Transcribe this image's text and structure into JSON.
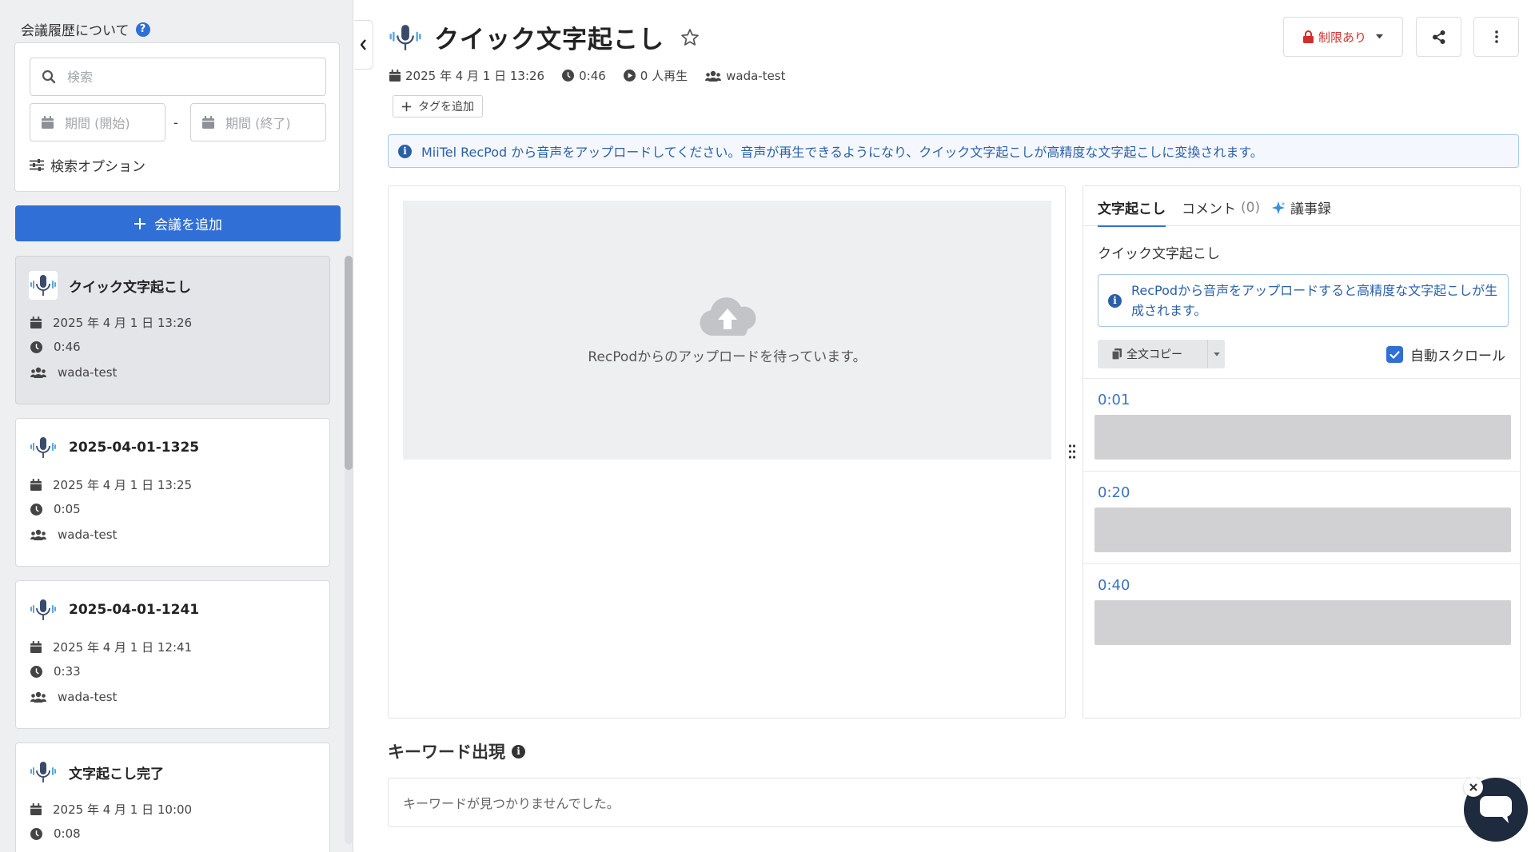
{
  "sidebar": {
    "title": "会議履歴について",
    "help_icon": "?",
    "search": {
      "placeholder": "検索",
      "value": ""
    },
    "date_start_placeholder": "期間 (開始)",
    "date_end_placeholder": "期間 (終了)",
    "date_separator": "-",
    "search_options_label": "検索オプション",
    "add_meeting_label": "会議を追加",
    "meetings": [
      {
        "title": "クイック文字起こし",
        "date": "2025 年 4 月 1 日 13:26",
        "duration": "0:46",
        "owner": "wada-test",
        "active": true
      },
      {
        "title": "2025-04-01-1325",
        "date": "2025 年 4 月 1 日 13:25",
        "duration": "0:05",
        "owner": "wada-test",
        "active": false
      },
      {
        "title": "2025-04-01-1241",
        "date": "2025 年 4 月 1 日 12:41",
        "duration": "0:33",
        "owner": "wada-test",
        "active": false
      },
      {
        "title": "文字起こし完了",
        "date": "2025 年 4 月 1 日 10:00",
        "duration": "0:08",
        "owner": "",
        "active": false
      }
    ]
  },
  "header": {
    "title": "クイック文字起こし",
    "date": "2025 年 4 月 1 日 13:26",
    "duration": "0:46",
    "plays": "0 人再生",
    "owner": "wada-test",
    "add_tag_label": "タグを追加",
    "restriction_label": "制限あり"
  },
  "banner": {
    "text": "MiiTel RecPod から音声をアップロードしてください。音声が再生できるようになり、クイック文字起こしが高精度な文字起こしに変換されます。"
  },
  "player": {
    "waiting_text": "RecPodからのアップロードを待っています。"
  },
  "transcript": {
    "tabs": [
      {
        "label": "文字起こし",
        "count": "",
        "active": true
      },
      {
        "label": "コメント",
        "count": "(0)",
        "active": false
      },
      {
        "label": "議事録",
        "count": "",
        "active": false
      }
    ],
    "heading": "クイック文字起こし",
    "info_text": "RecPodから音声をアップロードすると高精度な文字起こしが生成されます。",
    "copy_label": "全文コピー",
    "auto_scroll_label": "自動スクロール",
    "auto_scroll_checked": true,
    "segments": [
      {
        "time": "0:01"
      },
      {
        "time": "0:20"
      },
      {
        "time": "0:40"
      }
    ]
  },
  "keywords": {
    "title": "キーワード出現",
    "empty_text": "キーワードが見つかりませんでした。"
  },
  "colors": {
    "primary": "#2f6fd6",
    "danger": "#d22e2e",
    "info_text": "#2a5fa8",
    "chat_fab": "#1e2a3e"
  },
  "icons": [
    "help-icon",
    "search-icon",
    "calendar-icon",
    "sliders-icon",
    "plus-icon",
    "mic-icon",
    "clock-icon",
    "users-icon",
    "play-icon",
    "star-icon",
    "lock-icon",
    "caret-down-icon",
    "share-icon",
    "more-vertical-icon",
    "info-icon",
    "cloud-upload-icon",
    "copy-icon",
    "sparkle-icon",
    "check-icon",
    "chat-icon",
    "close-icon",
    "chevron-left-icon"
  ]
}
